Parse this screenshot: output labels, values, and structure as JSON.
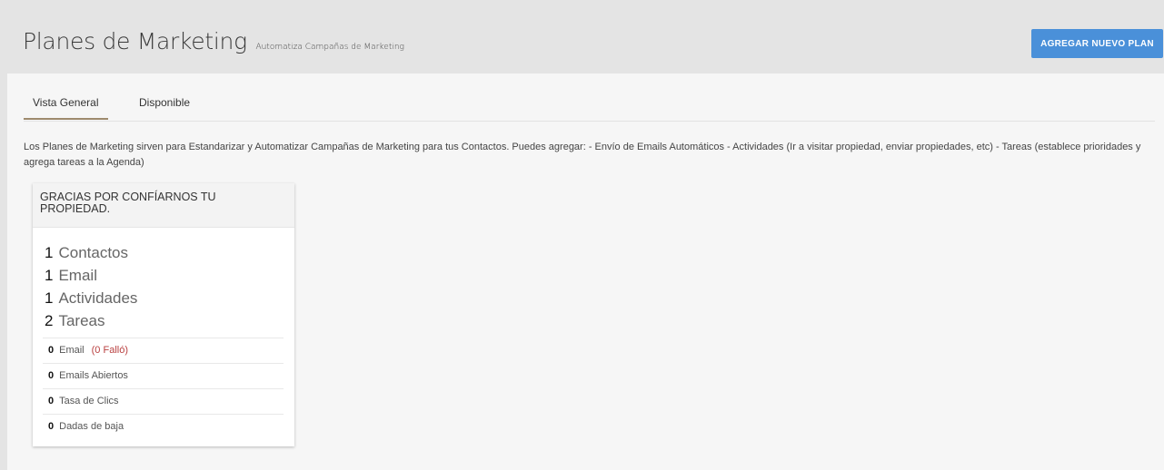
{
  "header": {
    "title": "Planes de Marketing",
    "subtitle": "Automatiza Campañas de Marketing",
    "add_button_label": "AGREGAR NUEVO PLAN"
  },
  "tabs": [
    {
      "label": "Vista General",
      "active": true
    },
    {
      "label": "Disponible",
      "active": false
    }
  ],
  "description": "Los Planes de Marketing sirven para Estandarizar y Automatizar Campañas de Marketing para tus Contactos. Puedes agregar: - Envío de Emails Automáticos - Actividades (Ir a visitar propiedad, enviar propiedades, etc) - Tareas (establece prioridades y agrega tareas a la Agenda)",
  "plan_card": {
    "title": "GRACIAS POR CONFÍARNOS TU PROPIEDAD.",
    "big_stats": [
      {
        "value": "1",
        "label": "Contactos"
      },
      {
        "value": "1",
        "label": "Email"
      },
      {
        "value": "1",
        "label": "Actividades"
      },
      {
        "value": "2",
        "label": "Tareas"
      }
    ],
    "small_stats": [
      {
        "value": "0",
        "label": "Email",
        "extra": "(0 Falló)"
      },
      {
        "value": "0",
        "label": "Emails Abiertos"
      },
      {
        "value": "0",
        "label": "Tasa de Clics"
      },
      {
        "value": "0",
        "label": "Dadas de baja"
      }
    ]
  },
  "colors": {
    "accent_button": "#4a90d9",
    "active_tab_underline": "#9e8a6d",
    "fail_text": "#b94040"
  }
}
